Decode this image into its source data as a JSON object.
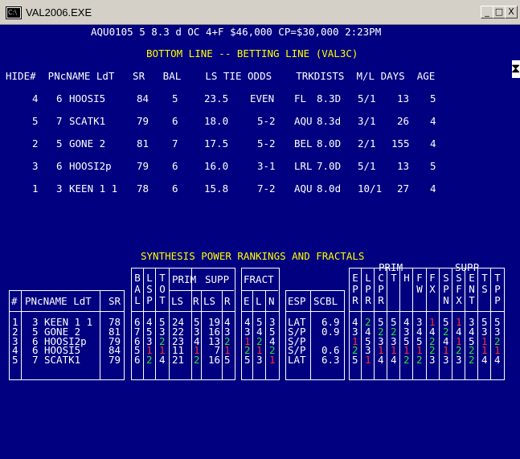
{
  "window": {
    "title": "VAL2006.EXE",
    "icon": "console-icon",
    "buttons": [
      "_",
      "□",
      "X"
    ]
  },
  "header_line": "AQU0105 5 8.3 d OC 4+F $46,000 CP=$30,000 2:23PM",
  "bottom_title": "BOTTOM LINE -- BETTING LINE (VAL3C)",
  "betting": {
    "columns": [
      "HIDE#",
      "PNc",
      "NAME LdT",
      "SR",
      "BAL",
      "LS",
      "TIE",
      "ODDS",
      "TRK",
      "DIST",
      "M/L",
      "DAYS",
      "AGE"
    ],
    "header_text": "HIDE#  PNcNAME LdT   SR   BAL    LS TIE ODDS    TRKDISTS  M/L DAYS  AGE",
    "rows": [
      {
        "hide": "4",
        "pn": "6",
        "name": "HOOSI5",
        "sr": "84",
        "bal": "5",
        "ls": "23.5",
        "odds": "EVEN",
        "trk": "FL",
        "dist": "8.3D",
        "ml": "5/1",
        "days": "13",
        "age": "5"
      },
      {
        "hide": "5",
        "pn": "7",
        "name": "SCATK1",
        "sr": "79",
        "bal": "6",
        "ls": "18.0",
        "odds": "5-2",
        "trk": "AQU",
        "dist": "8.3d",
        "ml": "3/1",
        "days": "26",
        "age": "4"
      },
      {
        "hide": "2",
        "pn": "5",
        "name": "GONE 2",
        "sr": "81",
        "bal": "7",
        "ls": "17.5",
        "odds": "5-2",
        "trk": "BEL",
        "dist": "8.0D",
        "ml": "2/1",
        "days": "155",
        "age": "4"
      },
      {
        "hide": "3",
        "pn": "6",
        "name": "HOOSI2p",
        "sr": "79",
        "bal": "6",
        "ls": "16.0",
        "odds": "3-1",
        "trk": "LRL",
        "dist": "7.0D",
        "ml": "5/1",
        "days": "13",
        "age": "5"
      },
      {
        "hide": "1",
        "pn": "3",
        "name": "KEEN 1 1",
        "sr": "78",
        "bal": "6",
        "ls": "15.8",
        "odds": "7-2",
        "trk": "AQU",
        "dist": "8.0d",
        "ml": "10/1",
        "days": "27",
        "age": "4"
      }
    ]
  },
  "synthesis": {
    "title": "SYNTHESIS POWER RANKINGS AND FRACTALS",
    "labels": {
      "hash": "#",
      "pnc_name": "PNcNAME LdT",
      "sr": "SR",
      "bal": "BAL",
      "lsp": "LSP",
      "tot": "TOT",
      "prim": "PRIM",
      "supp": "SUPP",
      "ls": "LS",
      "r": "R",
      "fract": "FRACT",
      "e": "E",
      "l": "L",
      "n": "N",
      "esp": "ESP",
      "scbl": "SCBL",
      "prim2": "PRIM",
      "supp2": "SUPP",
      "prim_cols": [
        "EPR",
        "LPR",
        "CPR",
        "T",
        "H",
        "FW",
        "FX"
      ],
      "supp_cols": [
        "SPN",
        "SFX",
        "ENT",
        "TS",
        "TPP"
      ]
    },
    "rows": [
      {
        "n": "1",
        "pn": "3",
        "name": "KEEN 1 1",
        "sr": "78",
        "bal": "6",
        "lsp": "4",
        "tot": "5",
        "prim_ls": "24",
        "prim_r": "5",
        "supp_ls": "19",
        "supp_r": "4",
        "e": "4",
        "l": "5",
        "nn": "3",
        "esp": "LAT",
        "scbl": "6.9",
        "p": [
          "4",
          "2",
          "5",
          "5",
          "4",
          "3",
          "1"
        ],
        "s": [
          "5",
          "1",
          "3",
          "5",
          "5"
        ]
      },
      {
        "n": "2",
        "pn": "5",
        "name": "GONE 2",
        "sr": "81",
        "bal": "7",
        "lsp": "5",
        "tot": "3",
        "prim_ls": "22",
        "prim_r": "3",
        "supp_ls": "16",
        "supp_r": "3",
        "e": "3",
        "l": "4",
        "nn": "5",
        "esp": "S/P",
        "scbl": "0.9",
        "p": [
          "3",
          "4",
          "2",
          "2",
          "3",
          "4",
          "4"
        ],
        "s": [
          "2",
          "4",
          "4",
          "3",
          "3"
        ]
      },
      {
        "n": "3",
        "pn": "6",
        "name": "HOOSI2p",
        "sr": "79",
        "bal": "6",
        "lsp": "3",
        "tot": "2",
        "prim_ls": "23",
        "prim_r": "4",
        "supp_ls": "13",
        "supp_r": "2",
        "e": "1",
        "l": "2",
        "nn": "4",
        "esp": "S/P",
        "scbl": "",
        "p": [
          "1",
          "5",
          "3",
          "3",
          "5",
          "5",
          "2"
        ],
        "s": [
          "4",
          "1",
          "5",
          "1",
          "2"
        ]
      },
      {
        "n": "4",
        "pn": "6",
        "name": "HOOSI5",
        "sr": "84",
        "bal": "5",
        "lsp": "1",
        "tot": "1",
        "prim_ls": "11",
        "prim_r": "1",
        "supp_ls": "7",
        "supp_r": "1",
        "e": "2",
        "l": "1",
        "nn": "2",
        "esp": "S/P",
        "scbl": "0.6",
        "p": [
          "2",
          "3",
          "1",
          "1",
          "1",
          "1",
          "2"
        ],
        "s": [
          "1",
          "2",
          "2",
          "1",
          "1"
        ]
      },
      {
        "n": "5",
        "pn": "7",
        "name": "SCATK1",
        "sr": "79",
        "bal": "6",
        "lsp": "2",
        "tot": "4",
        "prim_ls": "21",
        "prim_r": "2",
        "supp_ls": "16",
        "supp_r": "5",
        "e": "5",
        "l": "3",
        "nn": "1",
        "esp": "LAT",
        "scbl": "6.3",
        "p": [
          "5",
          "1",
          "4",
          "4",
          "2",
          "2",
          "3"
        ],
        "s": [
          "3",
          "3",
          "2",
          "4",
          "4"
        ]
      }
    ]
  },
  "colors": {
    "background": "#000080",
    "text": "#ffffff",
    "accent": "#ffff00",
    "rank1": "#ff3030",
    "rank2": "#33dd33"
  }
}
